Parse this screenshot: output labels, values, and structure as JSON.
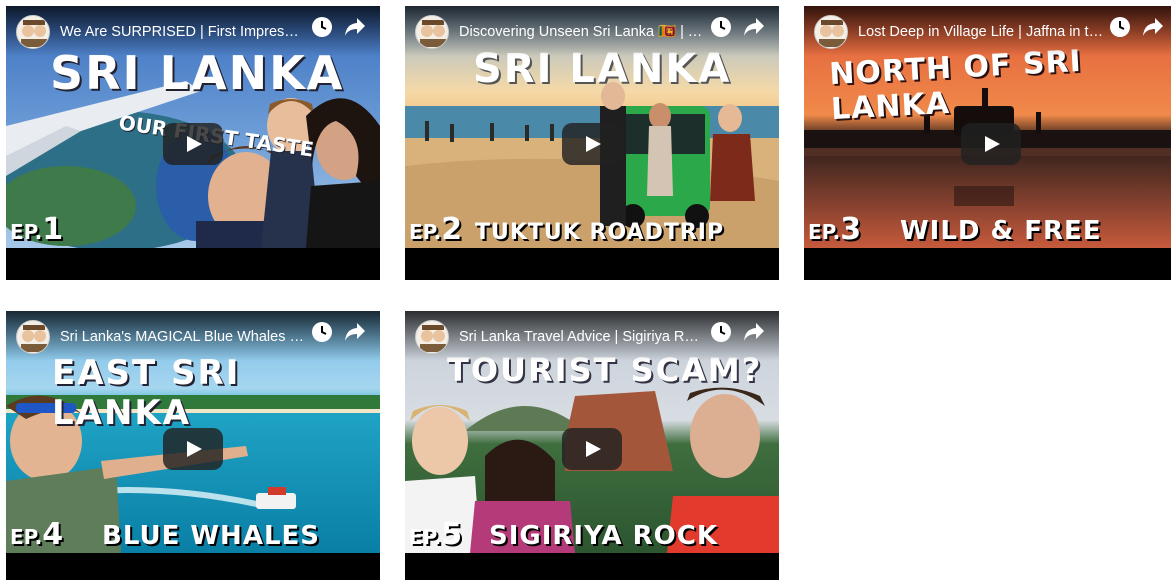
{
  "videos": [
    {
      "title": "We Are SURPRISED | First Impressions of Sri Lanka",
      "overlay": {
        "headline": "SRI LANKA",
        "subline": "OUR FIRST TASTE",
        "episode": "EP.",
        "episode_number": "1",
        "tag": ""
      }
    },
    {
      "title": "Discovering Unseen Sri Lanka 🇱🇰 | Tuktuk Roadtrip",
      "overlay": {
        "headline": "SRI LANKA",
        "subline": "",
        "episode": "EP.",
        "episode_number": "2",
        "tag": "TUKTUK ROADTRIP"
      }
    },
    {
      "title": "Lost Deep in Village Life | Jaffna in the North of Sri Lanka",
      "overlay": {
        "headline": "NORTH OF SRI LANKA",
        "subline": "",
        "episode": "EP.",
        "episode_number": "3",
        "tag": "WILD & FREE"
      }
    },
    {
      "title": "Sri Lanka's MAGICAL Blue Whales | East Sri Lanka",
      "overlay": {
        "headline": "EAST SRI LANKA",
        "subline": "",
        "episode": "EP.",
        "episode_number": "4",
        "tag": "BLUE WHALES"
      }
    },
    {
      "title": "Sri Lanka Travel Advice | Sigiriya Rock Tourist Scam?",
      "overlay": {
        "headline": "TOURIST SCAM?",
        "subline": "",
        "episode": "EP.",
        "episode_number": "5",
        "tag": "SIGIRIYA ROCK"
      }
    }
  ],
  "icons": {
    "watch_later": "clock-icon",
    "share": "share-arrow-icon",
    "play": "play-icon",
    "channel": "channel-avatar"
  },
  "colors": {
    "player_background": "#000000",
    "play_button": "#212121",
    "title_text": "#ffffff"
  }
}
